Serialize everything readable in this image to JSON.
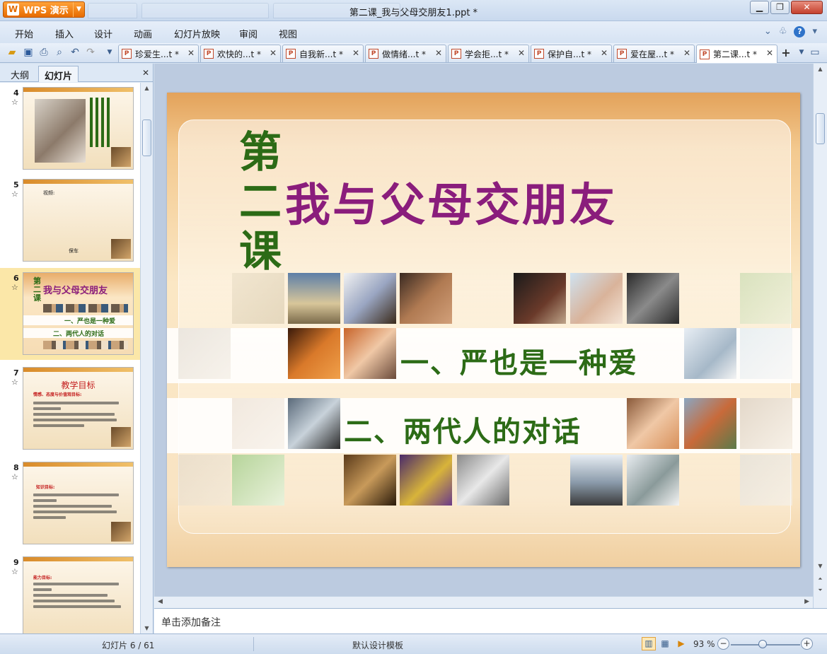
{
  "window": {
    "title": "第二课_我与父母交朋友1.ppt *",
    "app_button": "WPS 演示",
    "minimize": "▁",
    "restore": "❐",
    "close": "✕"
  },
  "menu": {
    "items": [
      "开始",
      "插入",
      "设计",
      "动画",
      "幻灯片放映",
      "审阅",
      "视图"
    ]
  },
  "doc_tabs": [
    {
      "label": "珍爱生...t *",
      "active": false
    },
    {
      "label": "欢快的...t *",
      "active": false
    },
    {
      "label": "自我新...t *",
      "active": false
    },
    {
      "label": "做情绪...t *",
      "active": false
    },
    {
      "label": "学会拒...t *",
      "active": false
    },
    {
      "label": "保护自...t *",
      "active": false
    },
    {
      "label": "爱在屋...t *",
      "active": false
    },
    {
      "label": "第二课...t *",
      "active": true
    }
  ],
  "left_panel": {
    "tab_outline": "大纲",
    "tab_slides": "幻灯片",
    "close": "✕",
    "thumbnails": [
      {
        "num": "4",
        "title": ""
      },
      {
        "num": "5",
        "title": "",
        "text_a": "视频:",
        "text_b": "保车"
      },
      {
        "num": "6",
        "title": "我与父母交朋友",
        "line1": "一、严也是一种爱",
        "line2": "二、两代人的对话",
        "selected": true
      },
      {
        "num": "7",
        "title": "教学目标",
        "heading": "情感、态度与价值观目标:"
      },
      {
        "num": "8",
        "title": "",
        "heading": "知识目标:"
      },
      {
        "num": "9",
        "title": "",
        "heading": "能力目标:"
      }
    ]
  },
  "slide": {
    "char1": "第",
    "char2": "二",
    "char3": "课",
    "title": "我与父母交朋友",
    "line1": "一、严也是一种爱",
    "line2": "二、两代人的对话"
  },
  "notes": {
    "placeholder": "单击添加备注"
  },
  "status": {
    "slide_counter": "幻灯片 6 / 61",
    "template": "默认设计模板",
    "zoom": "93 %",
    "zoom_minus": "−",
    "zoom_plus": "+"
  },
  "colors": {
    "title_purple": "#8a1d7c",
    "subtitle_green": "#2c6b16",
    "wps_orange": "#e76b00",
    "selected_thumb": "#fbe7a8"
  }
}
